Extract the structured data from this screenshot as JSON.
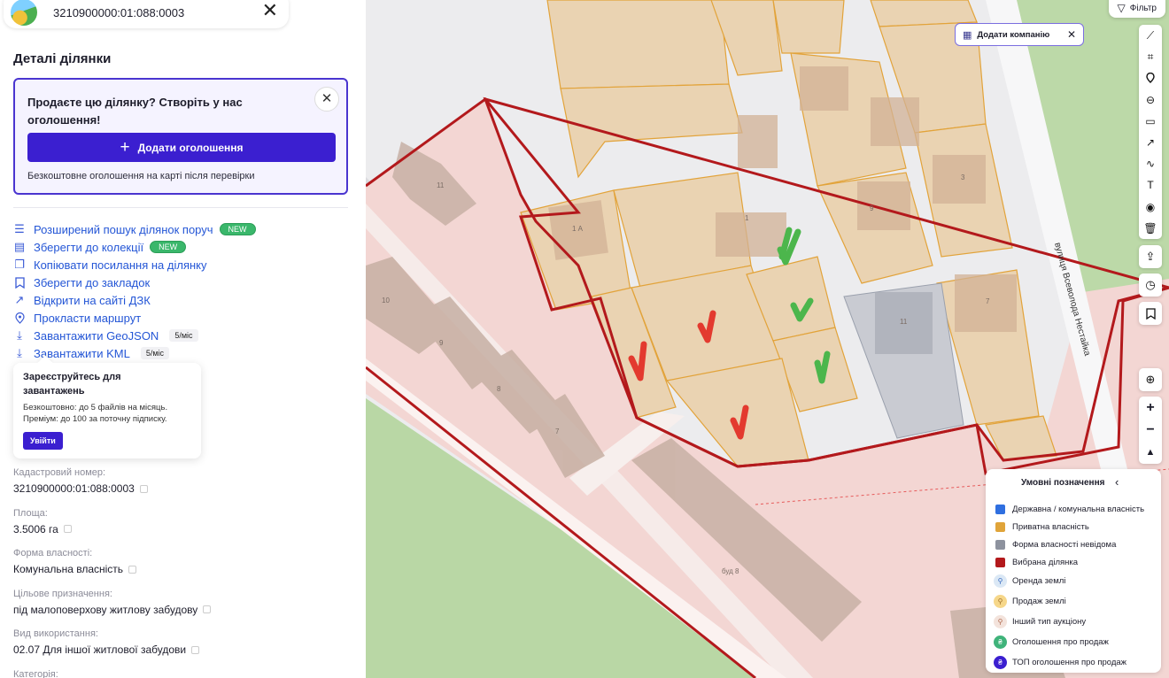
{
  "search": {
    "value": "3210900000:01:088:0003"
  },
  "panel": {
    "title": "Деталі ділянки",
    "promo": {
      "title": "Продаєте цю ділянку? Створіть у нас оголошення!",
      "button": "Додати оголошення",
      "note": "Безкоштовне оголошення на карті після перевірки"
    },
    "actions": [
      {
        "label": "Розширений пошук ділянок поруч",
        "icon": "sliders-icon",
        "badge": "NEW"
      },
      {
        "label": "Зберегти до колекції",
        "icon": "collection-icon",
        "badge": "NEW"
      },
      {
        "label": "Копіювати посилання на ділянку",
        "icon": "copy-link-icon"
      },
      {
        "label": "Зберегти до закладок",
        "icon": "bookmark-icon"
      },
      {
        "label": "Відкрити на сайті ДЗК",
        "icon": "external-link-icon"
      },
      {
        "label": "Прокласти маршрут",
        "icon": "route-pin-icon"
      },
      {
        "label": "Завантажити GeoJSON",
        "icon": "download-icon",
        "limit": "5/міс"
      },
      {
        "label": "Завантажити KML",
        "icon": "download-icon",
        "limit": "5/міс"
      }
    ],
    "tooltip": {
      "title": "Зареєструйтесь для завантажень",
      "line1": "Безкоштовно: до 5 файлів на місяць.",
      "line2": "Преміум: до 100 за поточну підписку.",
      "button": "Увійти"
    },
    "properties": [
      {
        "label": "Кадастровий номер:",
        "value": "3210900000:01:088:0003"
      },
      {
        "label": "Площа:",
        "value": "3.5006 га"
      },
      {
        "label": "Форма власності:",
        "value": "Комунальна власність"
      },
      {
        "label": "Цільове призначення:",
        "value": "під малоповерхову житлову забудову"
      },
      {
        "label": "Вид використання:",
        "value": "02.07 Для іншої житлової забудови"
      },
      {
        "label": "Категорія:",
        "value": ""
      }
    ]
  },
  "map": {
    "filter": "Фільтр",
    "add_company": "Додати компанію",
    "street_label": "вулиця Всеволода Нестайка",
    "parcel_labels": [
      "11",
      "10",
      "9",
      "8",
      "7",
      "1 А",
      "1",
      "9",
      "3",
      "7",
      "11",
      "буд 8"
    ],
    "toolbar_icons": [
      "line-icon",
      "polygon-icon",
      "marker-icon",
      "circle-icon",
      "rectangle-icon",
      "arrow-icon",
      "freehand-icon",
      "text-icon",
      "pin-icon",
      "trash-icon"
    ],
    "legend": {
      "title": "Умовні позначення",
      "items": [
        {
          "label": "Державна / комунальна власність",
          "color": "#2f6fe0"
        },
        {
          "label": "Приватна власність",
          "color": "#e0a43a"
        },
        {
          "label": "Форма власності невідома",
          "color": "#8d929e"
        },
        {
          "label": "Вибрана ділянка",
          "color": "#b3191c"
        },
        {
          "label": "Оренда землі",
          "color": "#dbe8f5"
        },
        {
          "label": "Продаж землі",
          "color": "#f6d78a"
        },
        {
          "label": "Інший тип аукціону",
          "color": "#f3e3dc"
        },
        {
          "label": "Оголошення про продаж",
          "color": "#3fb37a"
        },
        {
          "label": "ТОП оголошення про продаж",
          "color": "#3b1fd0"
        }
      ]
    }
  }
}
